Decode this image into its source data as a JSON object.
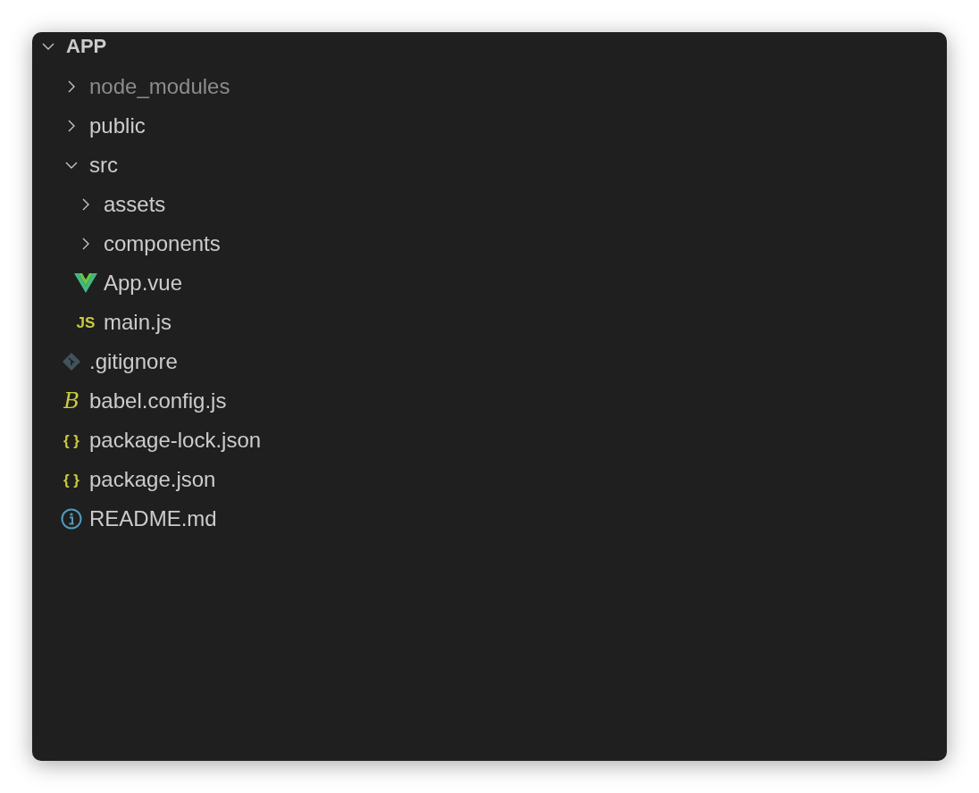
{
  "explorer": {
    "label": "APP",
    "expanded": true,
    "children": [
      {
        "kind": "folder",
        "label": "node_modules",
        "expanded": false,
        "ignored": true
      },
      {
        "kind": "folder",
        "label": "public",
        "expanded": false,
        "ignored": false
      },
      {
        "kind": "folder",
        "label": "src",
        "expanded": true,
        "ignored": false,
        "children": [
          {
            "kind": "folder",
            "label": "assets",
            "expanded": false,
            "ignored": false
          },
          {
            "kind": "folder",
            "label": "components",
            "expanded": false,
            "ignored": false
          },
          {
            "kind": "vue",
            "label": "App.vue"
          },
          {
            "kind": "glyph",
            "glyph": "JS",
            "color": "#cbcb41",
            "label": "main.js"
          }
        ]
      },
      {
        "kind": "git",
        "label": ".gitignore"
      },
      {
        "kind": "babel",
        "glyph": "B",
        "color": "#cbcb41",
        "label": "babel.config.js"
      },
      {
        "kind": "glyph",
        "glyph": "{ }",
        "color": "#cbcb41",
        "label": "package-lock.json"
      },
      {
        "kind": "glyph",
        "glyph": "{ }",
        "color": "#cbcb41",
        "label": "package.json"
      },
      {
        "kind": "info",
        "label": "README.md"
      }
    ]
  }
}
